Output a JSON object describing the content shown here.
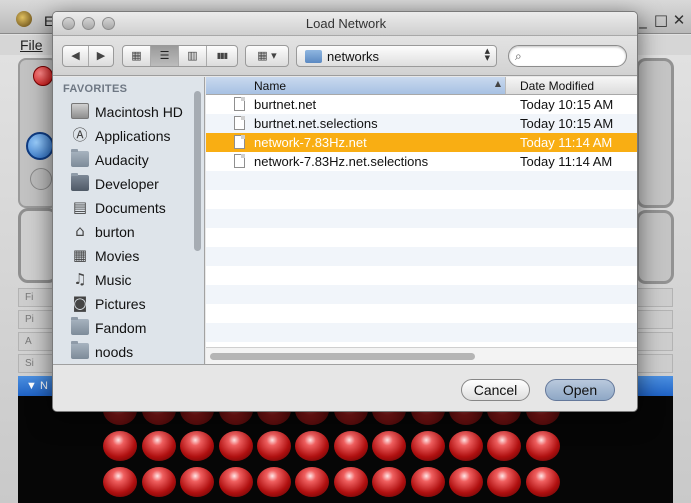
{
  "background_app": {
    "title": "E",
    "menu_file": "File",
    "controls": {
      "minimize": "_",
      "restore": "□",
      "close": "✕"
    },
    "collapsed_sections": [
      "Fi",
      "Pi",
      "A",
      "Si"
    ],
    "nav_section": "N"
  },
  "dialog": {
    "title": "Load Network",
    "toolbar": {
      "back_icon": "◀",
      "forward_icon": "▶",
      "view_icons": "▦",
      "view_list": "☰",
      "view_columns": "▥",
      "view_coverflow": "▮▮▮",
      "arrange_icon": "▦ ▾",
      "path_label": "networks",
      "path_arrows": "▲▼",
      "search_icon": "⌕",
      "search_value": "",
      "search_placeholder": ""
    },
    "sidebar": {
      "heading": "FAVORITES",
      "items": [
        {
          "label": "Macintosh HD",
          "icon": "drive-icon"
        },
        {
          "label": "Applications",
          "icon": "applications-icon"
        },
        {
          "label": "Audacity",
          "icon": "folder-icon"
        },
        {
          "label": "Developer",
          "icon": "folder-icon"
        },
        {
          "label": "Documents",
          "icon": "documents-icon"
        },
        {
          "label": "burton",
          "icon": "home-icon"
        },
        {
          "label": "Movies",
          "icon": "movies-icon"
        },
        {
          "label": "Music",
          "icon": "music-icon"
        },
        {
          "label": "Pictures",
          "icon": "pictures-icon"
        },
        {
          "label": "Fandom",
          "icon": "folder-icon"
        },
        {
          "label": "noods",
          "icon": "folder-icon"
        }
      ]
    },
    "file_list": {
      "columns": {
        "name": "Name",
        "date": "Date Modified",
        "sort_indicator": "▲"
      },
      "rows": [
        {
          "name": "burtnet.net",
          "date": "Today 10:15 AM",
          "selected": false
        },
        {
          "name": "burtnet.net.selections",
          "date": "Today 10:15 AM",
          "selected": false
        },
        {
          "name": "network-7.83Hz.net",
          "date": "Today 11:14 AM",
          "selected": true
        },
        {
          "name": "network-7.83Hz.net.selections",
          "date": "Today 11:14 AM",
          "selected": false
        }
      ]
    },
    "buttons": {
      "cancel": "Cancel",
      "open": "Open"
    }
  },
  "colors": {
    "selection": "#f9ae13",
    "sidebar_bg": "#dee4ea",
    "open_button": "#8ea7c5",
    "nav_bar": "#1f62c4",
    "led_red": "#b01010"
  }
}
